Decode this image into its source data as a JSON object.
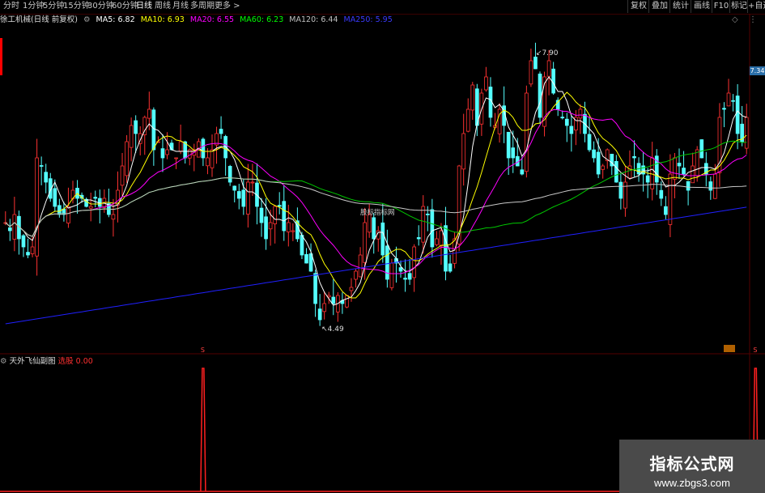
{
  "toolbar": {
    "periods": [
      "分时",
      "1分钟",
      "5分钟",
      "15分钟",
      "30分钟",
      "60分钟",
      "日线",
      "周线",
      "月线",
      "多周期",
      "更多 >"
    ],
    "active_period": "日线",
    "right_buttons": [
      "复权",
      "叠加",
      "统计",
      "画线",
      "F10",
      "标记",
      "+自选",
      "返"
    ]
  },
  "legend": {
    "stock": "徐工机械(日线 前复权)",
    "ma": [
      {
        "label": "MA5: 6.82",
        "color": "#ffffff"
      },
      {
        "label": "MA10: 6.93",
        "color": "#ffff00"
      },
      {
        "label": "MA20: 6.55",
        "color": "#ff00ff"
      },
      {
        "label": "MA60: 6.23",
        "color": "#00ff00"
      },
      {
        "label": "MA120: 6.44",
        "color": "#c0c0c0"
      },
      {
        "label": "MA250: 5.95",
        "color": "#3a3aff"
      }
    ]
  },
  "chart_data": {
    "type": "candlestick",
    "annotations": {
      "high_label": "7.90",
      "low_label": "4.49",
      "watermark_text": "股标指标网",
      "last_price": "7.34"
    },
    "closes": [
      5.8,
      5.7,
      5.9,
      5.6,
      5.5,
      5.4,
      5.5,
      6.6,
      6.5,
      6.3,
      6.1,
      6.0,
      5.9,
      5.9,
      6.0,
      6.2,
      6.1,
      6.1,
      6.0,
      6.0,
      6.1,
      6.0,
      6.1,
      5.9,
      5.9,
      6.2,
      6.5,
      6.8,
      7.0,
      6.9,
      6.9,
      7.1,
      7.2,
      6.7,
      6.8,
      6.6,
      6.7,
      6.7,
      6.6,
      6.8,
      6.6,
      6.7,
      6.7,
      6.8,
      6.6,
      6.6,
      6.7,
      6.9,
      6.9,
      6.6,
      6.3,
      6.2,
      6.1,
      6.0,
      6.3,
      6.3,
      6.0,
      5.8,
      5.6,
      5.8,
      6.0,
      6.0,
      5.7,
      5.8,
      5.7,
      5.6,
      5.4,
      5.3,
      5.2,
      4.8,
      4.6,
      4.8,
      4.9,
      4.8,
      4.9,
      4.8,
      4.9,
      5.0,
      5.2,
      5.4,
      5.8,
      5.9,
      5.6,
      5.7,
      5.4,
      5.1,
      5.3,
      5.3,
      5.2,
      5.1,
      5.1,
      5.5,
      5.6,
      6.0,
      5.9,
      5.5,
      5.6,
      5.7,
      5.2,
      5.2,
      5.6,
      6.5,
      6.9,
      7.2,
      7.5,
      7.0,
      7.4,
      7.6,
      7.1,
      7.0,
      7.2,
      7.0,
      6.6,
      6.6,
      6.5,
      6.4,
      7.4,
      7.8,
      7.7,
      7.1,
      7.6,
      7.8,
      7.4,
      7.2,
      7.1,
      7.0,
      6.9,
      7.1,
      7.2,
      6.9,
      6.7,
      6.6,
      6.4,
      6.5,
      6.7,
      6.5,
      6.3,
      6.1,
      6.3,
      6.5,
      6.6,
      6.4,
      6.4,
      6.3,
      6.6,
      6.3,
      6.1,
      5.9,
      6.4,
      6.6,
      6.5,
      6.4,
      6.2,
      6.5,
      6.7,
      6.6,
      6.4,
      6.2,
      6.4,
      7.1,
      7.2,
      7.4,
      7.3,
      6.9,
      6.8,
      7.1
    ],
    "signal_positions": [
      44,
      167,
      291
    ],
    "signal_value": "0.00"
  },
  "sub": {
    "name": "天外飞仙副图",
    "series_name": "选股",
    "series_value": "0.00"
  },
  "watermark": {
    "title": "指标公式网",
    "url": "www.zbgs3.com"
  }
}
